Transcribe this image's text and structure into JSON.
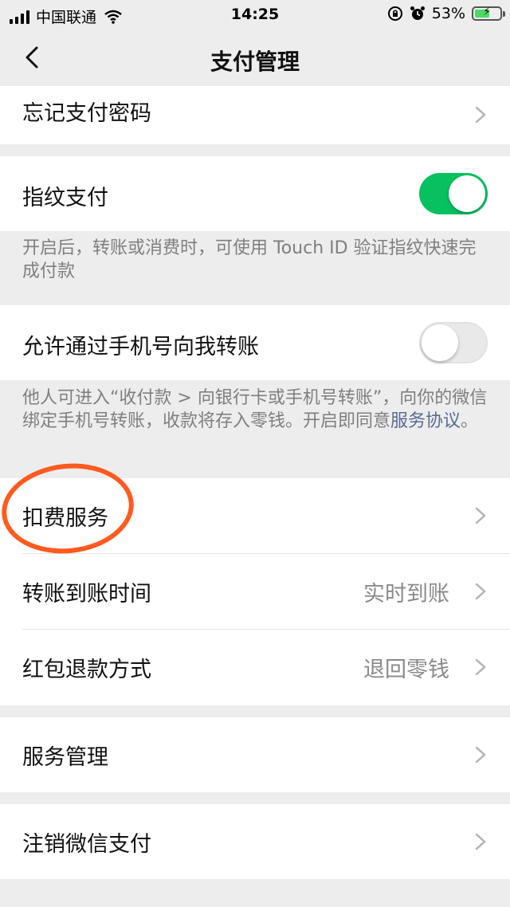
{
  "status_bar": {
    "carrier": "中国联通",
    "time": "14:25",
    "battery": "53%",
    "battery_level": 0.53
  },
  "nav": {
    "title": "支付管理"
  },
  "rows": {
    "forgot_password": {
      "label": "忘记支付密码"
    },
    "fingerprint": {
      "label": "指纹支付",
      "enabled": true
    },
    "fingerprint_desc": "开启后，转账或消费时，可使用 Touch ID 验证指纹快速完成付款",
    "phone_transfer": {
      "label": "允许通过手机号向我转账",
      "enabled": false
    },
    "phone_transfer_desc_1": "他人可进入“收付款 > 向银行卡或手机号转账”，向你的微信绑定手机号转账，收款将存入零钱。开启即同意",
    "phone_transfer_desc_link": "服务协议",
    "phone_transfer_desc_end": "。",
    "deduction": {
      "label": "扣费服务"
    },
    "transfer_time": {
      "label": "转账到账时间",
      "value": "实时到账"
    },
    "red_packet_refund": {
      "label": "红包退款方式",
      "value": "退回零钱"
    },
    "service_mgmt": {
      "label": "服务管理"
    },
    "deregister": {
      "label": "注销微信支付"
    }
  },
  "colors": {
    "accent_green": "#07c160",
    "link_blue": "#576b95",
    "annotation_orange": "#ff5a1f"
  }
}
